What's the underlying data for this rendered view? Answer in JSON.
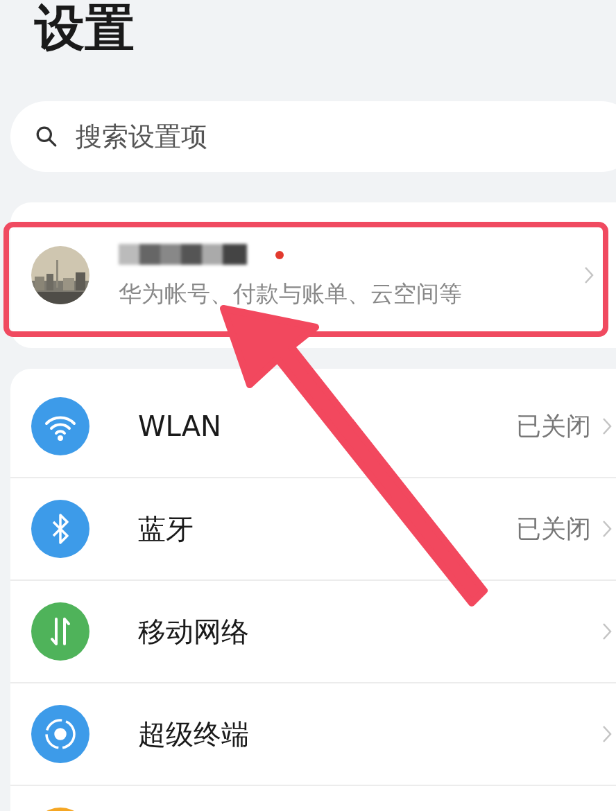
{
  "title": "设置",
  "search": {
    "placeholder": "搜索设置项"
  },
  "account": {
    "subtitle": "华为帐号、付款与账单、云空间等",
    "name_blurred": true,
    "unread_dot": true,
    "highlighted": true,
    "arrow": true
  },
  "items": [
    {
      "kind": "wifi",
      "label": "WLAN",
      "value": "已关闭",
      "color": "#3d9be9"
    },
    {
      "kind": "bluetooth",
      "label": "蓝牙",
      "value": "已关闭",
      "color": "#3d9be9"
    },
    {
      "kind": "mobile",
      "label": "移动网络",
      "color": "#4fb35a"
    },
    {
      "kind": "terminal",
      "label": "超级终端",
      "color": "#3d9be9"
    },
    {
      "kind": "partial",
      "color": "#f5a623"
    }
  ]
}
